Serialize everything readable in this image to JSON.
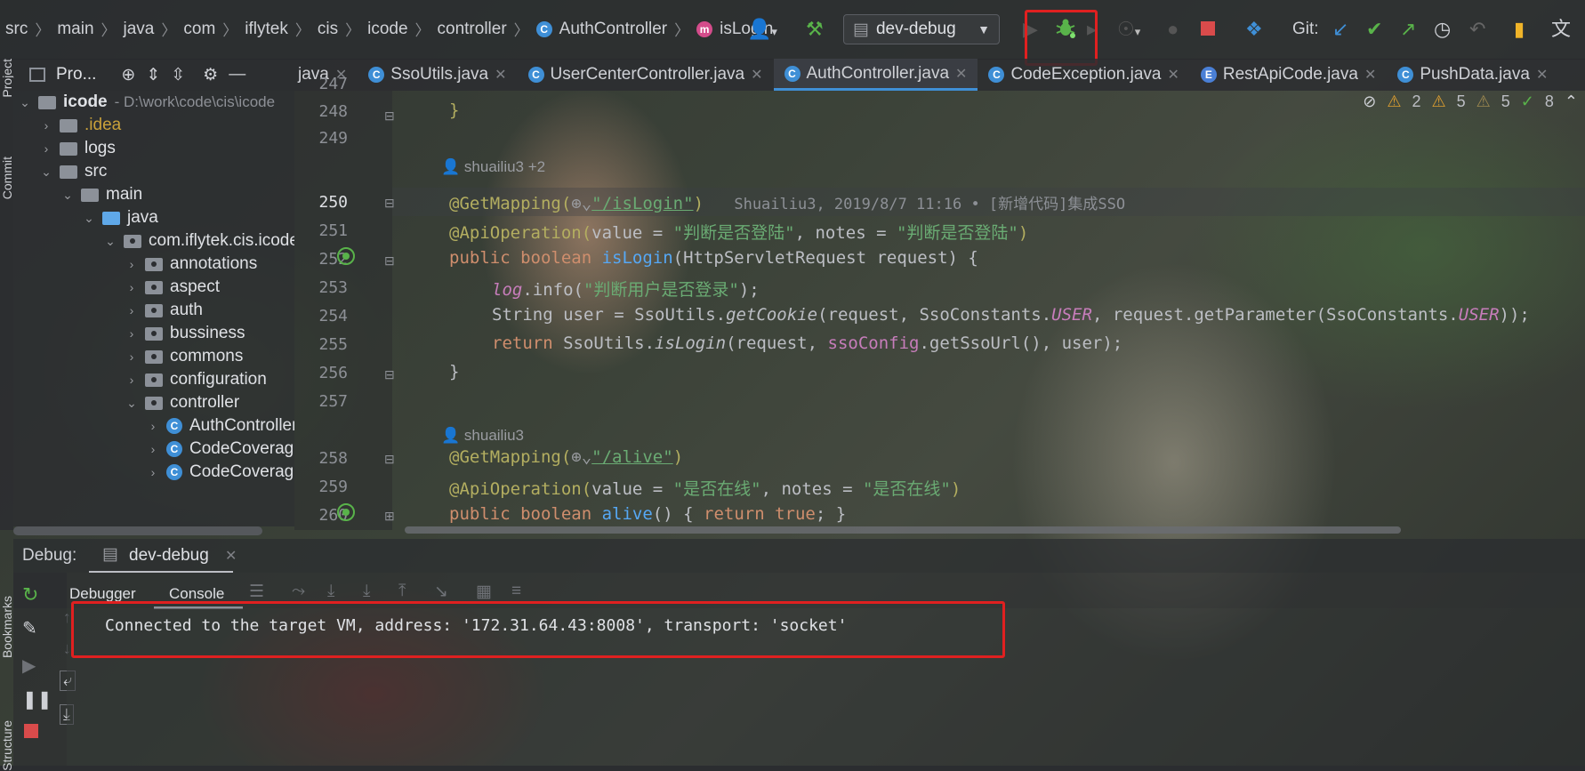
{
  "breadcrumb": {
    "items": [
      "src",
      "main",
      "java",
      "com",
      "iflytek",
      "cis",
      "icode",
      "controller",
      "AuthController",
      "isLogin"
    ]
  },
  "toolbar": {
    "run_config": "dev-debug",
    "git_label": "Git:"
  },
  "project_panel": {
    "title": "Pro...",
    "tree": [
      {
        "label": "icode",
        "suffix": "- D:\\work\\code\\cis\\icode",
        "depth": 0,
        "expanded": true,
        "icon": "module-folder-icon"
      },
      {
        "label": ".idea",
        "depth": 1,
        "expanded": false,
        "icon": "folder-icon"
      },
      {
        "label": "logs",
        "depth": 1,
        "expanded": false,
        "icon": "folder-icon"
      },
      {
        "label": "src",
        "depth": 1,
        "expanded": true,
        "icon": "folder-icon"
      },
      {
        "label": "main",
        "depth": 2,
        "expanded": true,
        "icon": "folder-icon"
      },
      {
        "label": "java",
        "depth": 3,
        "expanded": true,
        "icon": "source-folder-icon"
      },
      {
        "label": "com.iflytek.cis.icode",
        "depth": 4,
        "expanded": true,
        "icon": "package-icon"
      },
      {
        "label": "annotations",
        "depth": 5,
        "expanded": false,
        "icon": "package-icon"
      },
      {
        "label": "aspect",
        "depth": 5,
        "expanded": false,
        "icon": "package-icon"
      },
      {
        "label": "auth",
        "depth": 5,
        "expanded": false,
        "icon": "package-icon"
      },
      {
        "label": "bussiness",
        "depth": 5,
        "expanded": false,
        "icon": "package-icon"
      },
      {
        "label": "commons",
        "depth": 5,
        "expanded": false,
        "icon": "package-icon"
      },
      {
        "label": "configuration",
        "depth": 5,
        "expanded": false,
        "icon": "package-icon"
      },
      {
        "label": "controller",
        "depth": 5,
        "expanded": true,
        "icon": "package-icon"
      },
      {
        "label": "AuthController",
        "depth": 6,
        "expanded": false,
        "icon": "class-icon"
      },
      {
        "label": "CodeCoverage",
        "depth": 6,
        "expanded": false,
        "icon": "class-icon"
      },
      {
        "label": "CodeCoverage",
        "depth": 6,
        "expanded": false,
        "icon": "class-icon"
      }
    ]
  },
  "tabs": [
    {
      "label": "java",
      "icon": ""
    },
    {
      "label": "SsoUtils.java",
      "icon": "class-icon"
    },
    {
      "label": "UserCenterController.java",
      "icon": "class-icon"
    },
    {
      "label": "AuthController.java",
      "icon": "class-icon",
      "active": true
    },
    {
      "label": "CodeException.java",
      "icon": "class-icon"
    },
    {
      "label": "RestApiCode.java",
      "icon": "enum-icon"
    },
    {
      "label": "PushData.java",
      "icon": "class-icon"
    }
  ],
  "inspections": {
    "warn1": "2",
    "warn2": "5",
    "weak": "5",
    "typo": "8"
  },
  "editor": {
    "line_numbers": [
      "247",
      "248",
      "249",
      "250",
      "251",
      "252",
      "253",
      "254",
      "255",
      "256",
      "257",
      "258",
      "259",
      "260"
    ],
    "author_hint_1": "shuailiu3 +2",
    "author_hint_2": "shuailiu3",
    "blame_250": "Shuailiu3, 2019/8/7 11:16 • [新增代码]集成SSO",
    "l248": "}",
    "l250_ann": "@GetMapping(",
    "l250_str": "\"/isLogin\"",
    "l250_end": ")",
    "l251_ann": "@ApiOperation(",
    "l251_a": "value = ",
    "l251_s1": "\"判断是否登陆\"",
    "l251_b": ", notes = ",
    "l251_s2": "\"判断是否登陆\"",
    "l251_end": ")",
    "l252_kw": "public boolean ",
    "l252_fn": "isLogin",
    "l252_rest": "(HttpServletRequest request) {",
    "l253_field": "log",
    "l253_mid": ".info(",
    "l253_str": "\"判断用户是否登录\"",
    "l253_end": ");",
    "l254_a": "String user = SsoUtils.",
    "l254_m": "getCookie",
    "l254_b": "(request, SsoConstants.",
    "l254_f1": "USER",
    "l254_c": ", request.getParameter(SsoConstants.",
    "l254_f2": "USER",
    "l254_end": "));",
    "l255_kw": "return ",
    "l255_a": "SsoUtils.",
    "l255_m": "isLogin",
    "l255_b": "(request, ",
    "l255_f": "ssoConfig",
    "l255_end": ".getSsoUrl(), user);",
    "l256": "}",
    "l258_ann": "@GetMapping(",
    "l258_str": "\"/alive\"",
    "l258_end": ")",
    "l259_ann": "@ApiOperation(",
    "l259_a": "value = ",
    "l259_s1": "\"是否在线\"",
    "l259_b": ", notes = ",
    "l259_s2": "\"是否在线\"",
    "l259_end": ")",
    "l260_kw": "public boolean ",
    "l260_fn": "alive",
    "l260_a": "() { ",
    "l260_kw2": "return true",
    "l260_end": "; }"
  },
  "debug": {
    "label": "Debug:",
    "session": "dev-debug",
    "tab_debugger": "Debugger",
    "tab_console": "Console",
    "console_line": "Connected to the target VM, address: '172.31.64.43:8008', transport: 'socket'"
  },
  "side_labels": {
    "project": "Project",
    "commit": "Commit",
    "bookmarks": "Bookmarks",
    "structure": "Structure"
  },
  "colors": {
    "accent": "#3f8fd6",
    "highlight_box": "#e02020",
    "debug_bug": "#59b34a"
  }
}
